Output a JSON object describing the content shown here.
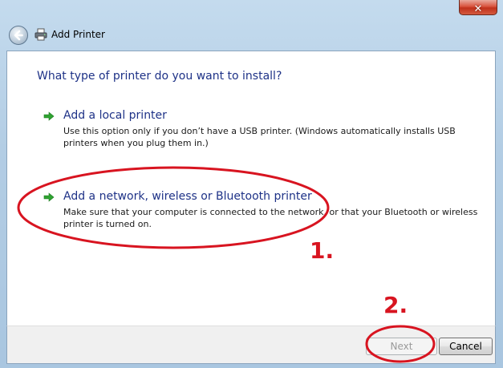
{
  "window": {
    "title": "Add Printer",
    "close_glyph": "✕"
  },
  "content": {
    "heading": "What type of printer do you want to install?",
    "options": [
      {
        "title": "Add a local printer",
        "description": "Use this option only if you don’t have a USB printer. (Windows automatically installs USB printers when you plug them in.)"
      },
      {
        "title": "Add a network, wireless or Bluetooth printer",
        "description": "Make sure that your computer is connected to the network, or that your Bluetooth or wireless printer is turned on."
      }
    ]
  },
  "footer": {
    "next_label": "Next",
    "cancel_label": "Cancel"
  },
  "annotations": {
    "step1": "1.",
    "step2": "2.",
    "color": "#d81420"
  },
  "icons": {
    "back": "back-arrow-icon",
    "printer": "printer-icon",
    "option_arrow": "green-arrow-icon"
  },
  "colors": {
    "link_blue": "#1e3287",
    "arrow_green": "#2fa331",
    "close_red": "#c7402a"
  }
}
